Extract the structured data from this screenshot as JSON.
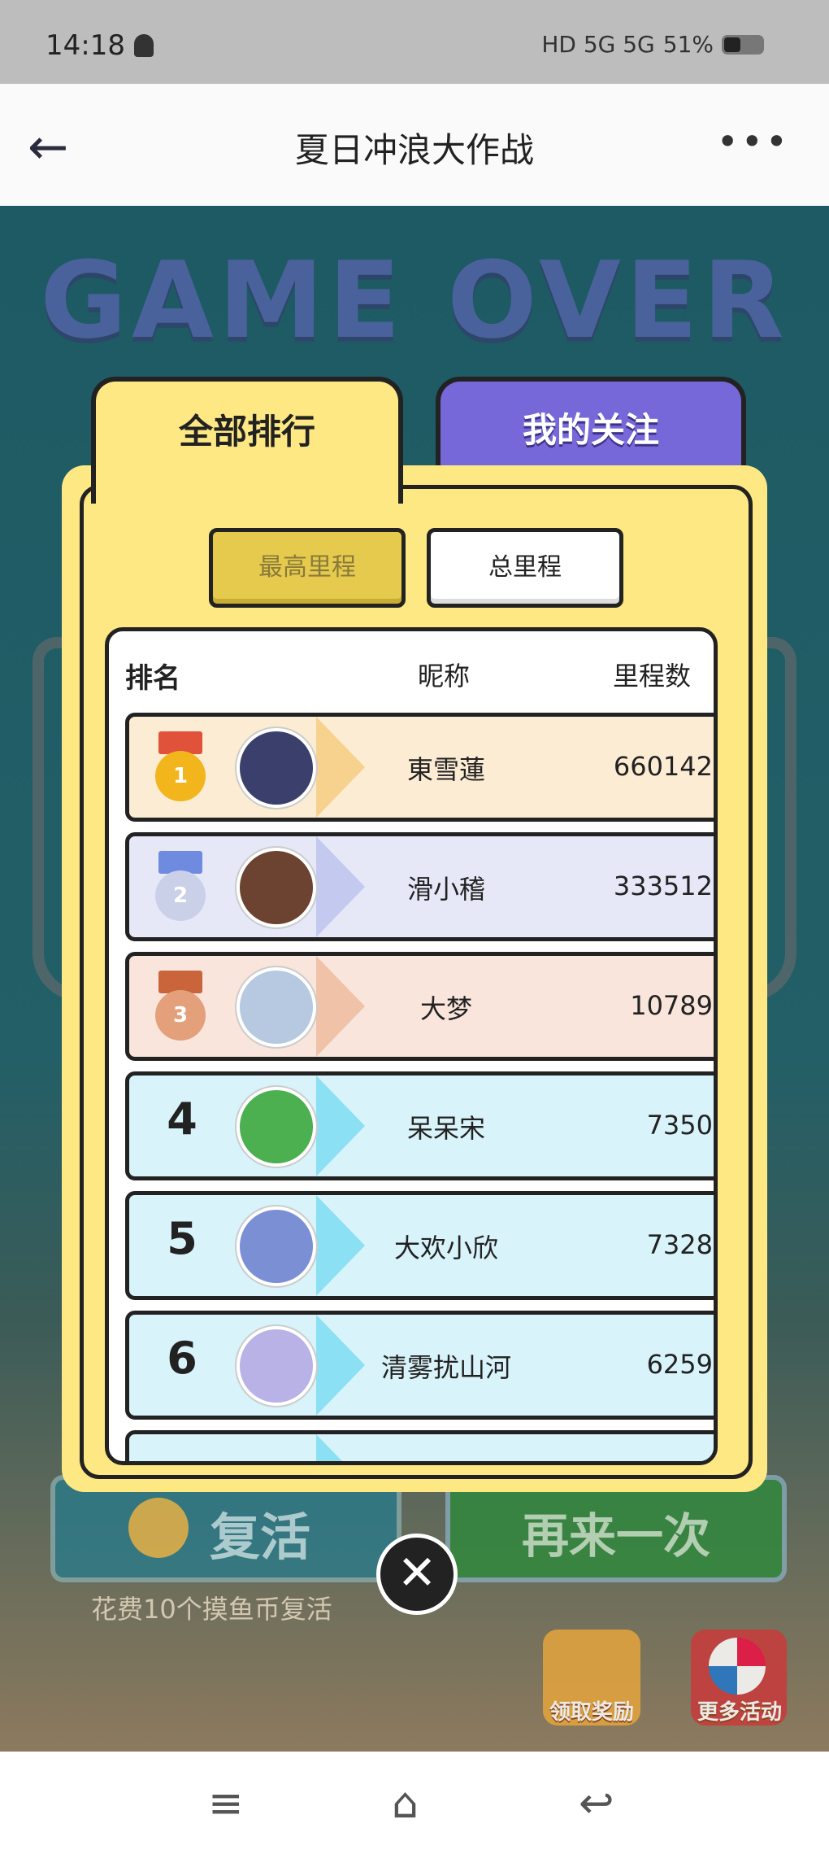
{
  "status_bar": {
    "time": "14:18",
    "signal_text": "HD 5G 5G",
    "battery": "51%"
  },
  "top_bar": {
    "back": "←",
    "title": "夏日冲浪大作战",
    "more": "•••"
  },
  "game": {
    "game_over": "GAME OVER",
    "revive_label": "复活",
    "again_label": "再来一次",
    "revive_tip": "花费10个摸鱼币复活",
    "reward_label": "领取奖励",
    "more_activities_label": "更多活动",
    "close": "✕"
  },
  "ranking": {
    "tabs": {
      "all": "全部排行",
      "following": "我的关注"
    },
    "subtabs": {
      "best": "最高里程",
      "total": "总里程"
    },
    "headers": {
      "rank": "排名",
      "nickname": "昵称",
      "distance": "里程数"
    },
    "rows": [
      {
        "rank": "1",
        "name": "東雪蓮",
        "score": "660142",
        "avatar_color": "#3a3f6b"
      },
      {
        "rank": "2",
        "name": "滑小稽",
        "score": "333512",
        "avatar_color": "#6b4330"
      },
      {
        "rank": "3",
        "name": "大梦",
        "score": "10789",
        "avatar_color": "#b7c9e0"
      },
      {
        "rank": "4",
        "name": "呆呆宋",
        "score": "7350",
        "avatar_color": "#4caf50"
      },
      {
        "rank": "5",
        "name": "大欢小欣",
        "score": "7328",
        "avatar_color": "#7b8fd4"
      },
      {
        "rank": "6",
        "name": "清雾扰山河",
        "score": "6259",
        "avatar_color": "#b9b2e6"
      }
    ]
  },
  "nav": {
    "menu": "≡",
    "home": "⌂",
    "back": "↩"
  }
}
